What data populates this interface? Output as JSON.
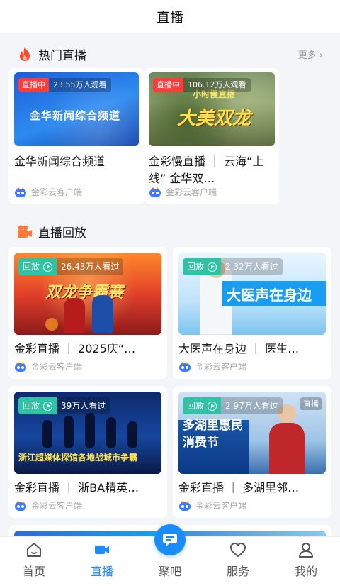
{
  "header": {
    "title": "直播"
  },
  "hot": {
    "title": "热门直播",
    "more": "更多 ›",
    "cards": [
      {
        "badge": "直播中",
        "viewers": "23.55万人观看",
        "thumb_text": "金华新闻综合频道",
        "title": "金华新闻综合频道",
        "source": "金彩云客户端"
      },
      {
        "badge": "直播中",
        "viewers": "106.12万人观看",
        "thumb_text": "大美双龙",
        "thumb_subtext": "小时慢直播",
        "title": "金彩慢直播 ｜ 云海“上线” 金华双…",
        "source": "金彩云客户端"
      }
    ]
  },
  "replay": {
    "title": "直播回放",
    "cards": [
      {
        "badge": "回放",
        "viewers": "26.43万人看过",
        "thumb_text": "双龙争霸赛",
        "title": "金彩直播 ｜ 2025庆“…",
        "source": "金彩云客户端"
      },
      {
        "badge": "回放",
        "viewers": "2.32万人看过",
        "thumb_text": "大医声在身边",
        "title": "大医声在身边 ｜ 医生…",
        "source": "金彩云客户端"
      },
      {
        "badge": "回放",
        "viewers": "39万人看过",
        "thumb_text": "浙江超媒体探馆各地战城市争霸",
        "title": "金彩直播 ｜ 浙BA精英…",
        "source": "金彩云客户端"
      },
      {
        "badge": "回放",
        "viewers": "2.97万人看过",
        "thumb_text": "多湖里惠民消费节",
        "thumb_corner": "直播",
        "title": "金彩直播 ｜ 多湖里邻…",
        "source": "金彩云客户端"
      }
    ]
  },
  "tabs": [
    {
      "label": "首页",
      "icon": "home-icon"
    },
    {
      "label": "直播",
      "icon": "video-camera-icon"
    },
    {
      "label": "聚吧",
      "icon": "chat-bubble-icon"
    },
    {
      "label": "服务",
      "icon": "heart-icon"
    },
    {
      "label": "我的",
      "icon": "user-icon"
    }
  ],
  "colors": {
    "accent": "#1a8cff",
    "live_red": "#ff3b3b",
    "replay_green": "#2ec3a5"
  }
}
